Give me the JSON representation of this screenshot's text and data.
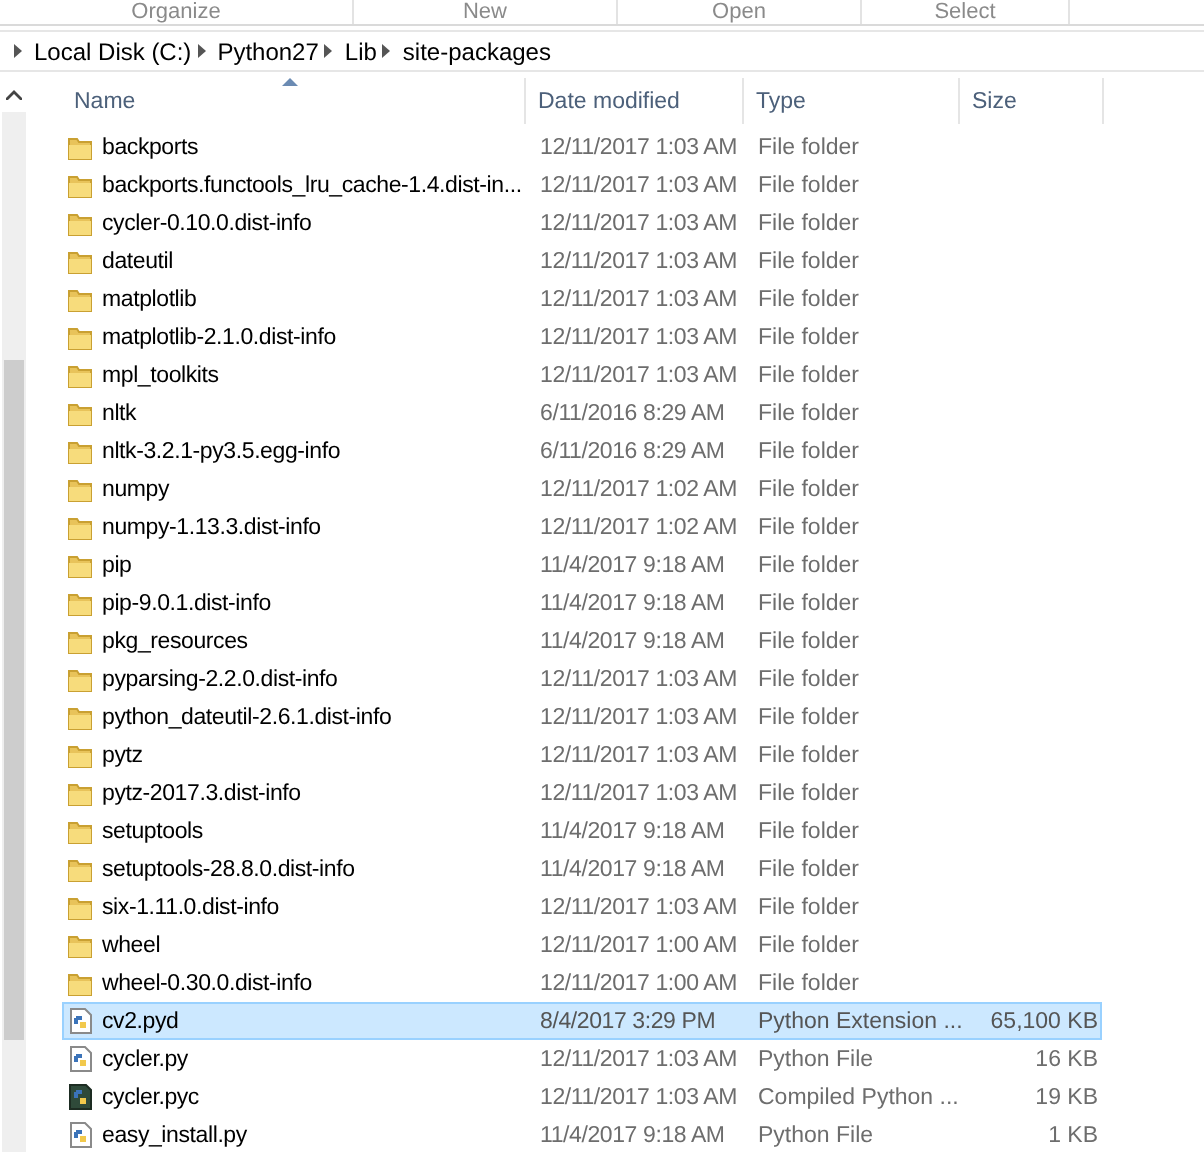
{
  "ribbon": {
    "groups": [
      "Organize",
      "New",
      "Open",
      "Select"
    ]
  },
  "breadcrumb": [
    "Local Disk (C:)",
    "Python27",
    "Lib",
    "site-packages"
  ],
  "columns": [
    {
      "label": "Name",
      "sorted": true
    },
    {
      "label": "Date modified",
      "sorted": false
    },
    {
      "label": "Type",
      "sorted": false
    },
    {
      "label": "Size",
      "sorted": false
    }
  ],
  "files": [
    {
      "kind": "folder",
      "name": "backports",
      "date": "12/11/2017 1:03 AM",
      "type": "File folder",
      "selected": false
    },
    {
      "kind": "folder",
      "name": "backports.functools_lru_cache-1.4.dist-in...",
      "date": "12/11/2017 1:03 AM",
      "type": "File folder",
      "selected": false
    },
    {
      "kind": "folder",
      "name": "cycler-0.10.0.dist-info",
      "date": "12/11/2017 1:03 AM",
      "type": "File folder",
      "selected": false
    },
    {
      "kind": "folder",
      "name": "dateutil",
      "date": "12/11/2017 1:03 AM",
      "type": "File folder",
      "selected": false
    },
    {
      "kind": "folder",
      "name": "matplotlib",
      "date": "12/11/2017 1:03 AM",
      "type": "File folder",
      "selected": false
    },
    {
      "kind": "folder",
      "name": "matplotlib-2.1.0.dist-info",
      "date": "12/11/2017 1:03 AM",
      "type": "File folder",
      "selected": false
    },
    {
      "kind": "folder",
      "name": "mpl_toolkits",
      "date": "12/11/2017 1:03 AM",
      "type": "File folder",
      "selected": false
    },
    {
      "kind": "folder",
      "name": "nltk",
      "date": "6/11/2016 8:29 AM",
      "type": "File folder",
      "selected": false
    },
    {
      "kind": "folder",
      "name": "nltk-3.2.1-py3.5.egg-info",
      "date": "6/11/2016 8:29 AM",
      "type": "File folder",
      "selected": false
    },
    {
      "kind": "folder",
      "name": "numpy",
      "date": "12/11/2017 1:02 AM",
      "type": "File folder",
      "selected": false
    },
    {
      "kind": "folder",
      "name": "numpy-1.13.3.dist-info",
      "date": "12/11/2017 1:02 AM",
      "type": "File folder",
      "selected": false
    },
    {
      "kind": "folder",
      "name": "pip",
      "date": "11/4/2017 9:18 AM",
      "type": "File folder",
      "selected": false
    },
    {
      "kind": "folder",
      "name": "pip-9.0.1.dist-info",
      "date": "11/4/2017 9:18 AM",
      "type": "File folder",
      "selected": false
    },
    {
      "kind": "folder",
      "name": "pkg_resources",
      "date": "11/4/2017 9:18 AM",
      "type": "File folder",
      "selected": false
    },
    {
      "kind": "folder",
      "name": "pyparsing-2.2.0.dist-info",
      "date": "12/11/2017 1:03 AM",
      "type": "File folder",
      "selected": false
    },
    {
      "kind": "folder",
      "name": "python_dateutil-2.6.1.dist-info",
      "date": "12/11/2017 1:03 AM",
      "type": "File folder",
      "selected": false
    },
    {
      "kind": "folder",
      "name": "pytz",
      "date": "12/11/2017 1:03 AM",
      "type": "File folder",
      "selected": false
    },
    {
      "kind": "folder",
      "name": "pytz-2017.3.dist-info",
      "date": "12/11/2017 1:03 AM",
      "type": "File folder",
      "selected": false
    },
    {
      "kind": "folder",
      "name": "setuptools",
      "date": "11/4/2017 9:18 AM",
      "type": "File folder",
      "selected": false
    },
    {
      "kind": "folder",
      "name": "setuptools-28.8.0.dist-info",
      "date": "11/4/2017 9:18 AM",
      "type": "File folder",
      "selected": false
    },
    {
      "kind": "folder",
      "name": "six-1.11.0.dist-info",
      "date": "12/11/2017 1:03 AM",
      "type": "File folder",
      "selected": false
    },
    {
      "kind": "folder",
      "name": "wheel",
      "date": "12/11/2017 1:00 AM",
      "type": "File folder",
      "selected": false
    },
    {
      "kind": "folder",
      "name": "wheel-0.30.0.dist-info",
      "date": "12/11/2017 1:00 AM",
      "type": "File folder",
      "selected": false
    },
    {
      "kind": "pyd",
      "name": "cv2.pyd",
      "date": "8/4/2017 3:29 PM",
      "type": "Python Extension ...",
      "size": "65,100 KB",
      "selected": true
    },
    {
      "kind": "py",
      "name": "cycler.py",
      "date": "12/11/2017 1:03 AM",
      "type": "Python File",
      "size": "16 KB",
      "selected": false
    },
    {
      "kind": "pyc",
      "name": "cycler.pyc",
      "date": "12/11/2017 1:03 AM",
      "type": "Compiled Python ...",
      "size": "19 KB",
      "selected": false
    },
    {
      "kind": "py",
      "name": "easy_install.py",
      "date": "11/4/2017 9:18 AM",
      "type": "Python File",
      "size": "1 KB",
      "selected": false
    }
  ]
}
